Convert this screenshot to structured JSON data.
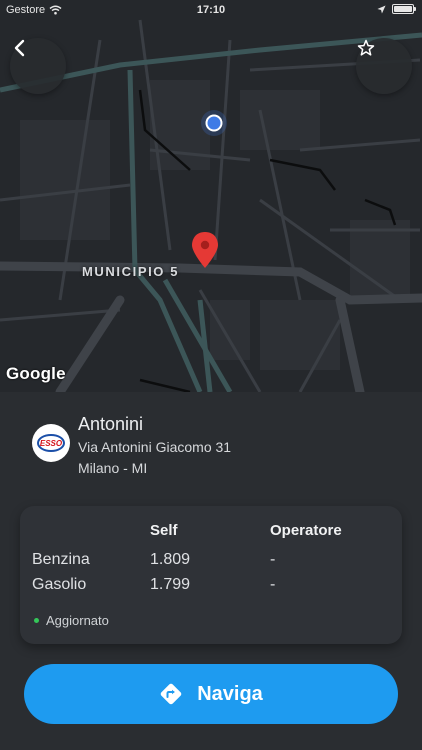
{
  "status_bar": {
    "carrier": "Gestore",
    "time": "17:10"
  },
  "map": {
    "area_label": "MUNICIPIO 5",
    "attribution": "Google"
  },
  "station": {
    "brand_logo_text": "ESSO",
    "name": "Antonini",
    "address": "Via Antonini Giacomo 31",
    "city": "Milano - MI"
  },
  "prices": {
    "headers": {
      "self": "Self",
      "operator": "Operatore"
    },
    "rows": [
      {
        "fuel": "Benzina",
        "self": "1.809",
        "operator": "-"
      },
      {
        "fuel": "Gasolio",
        "self": "1.799",
        "operator": "-"
      }
    ],
    "status": "Aggiornato",
    "status_color": "#34c759"
  },
  "actions": {
    "navigate_label": "Naviga"
  },
  "colors": {
    "accent": "#1e9bf0",
    "pin": "#e53935",
    "user_location": "#3f7be6"
  }
}
